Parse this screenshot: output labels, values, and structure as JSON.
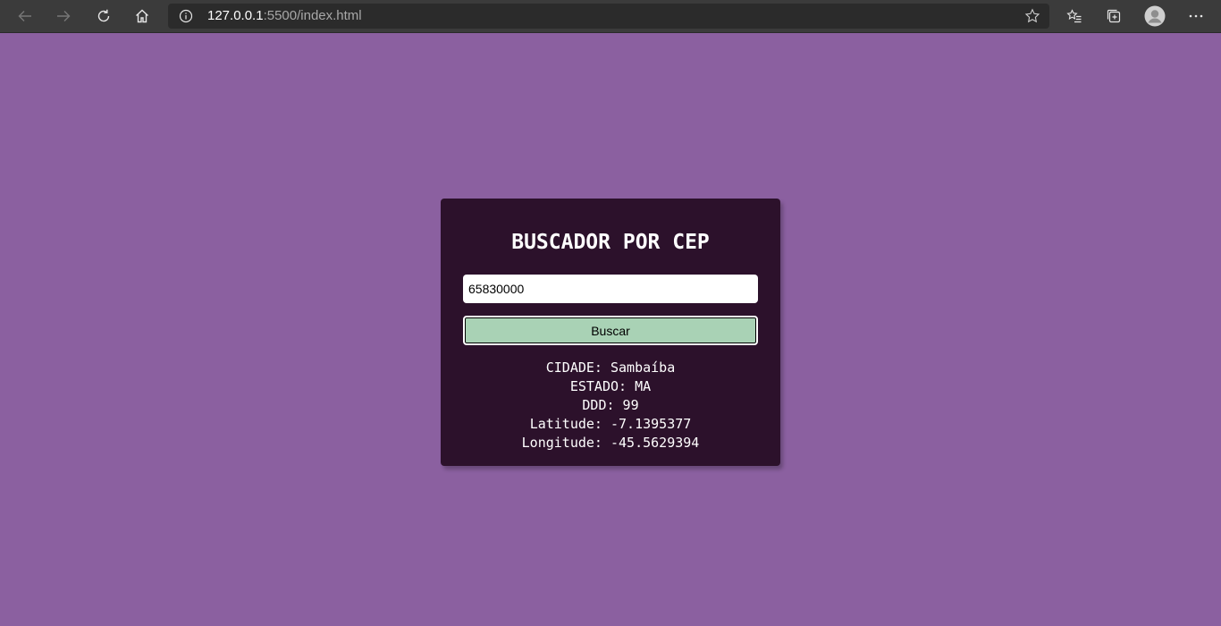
{
  "browser": {
    "url_host": "127.0.0.1",
    "url_rest": ":5500/index.html"
  },
  "app": {
    "title": "BUSCADOR POR CEP",
    "cep_value": "65830000",
    "button_label": "Buscar",
    "results": [
      {
        "label": "CIDADE:",
        "value": "Sambaíba"
      },
      {
        "label": "ESTADO:",
        "value": "MA"
      },
      {
        "label": "DDD:",
        "value": "99"
      },
      {
        "label": "Latitude:",
        "value": "-7.1395377"
      },
      {
        "label": "Longitude:",
        "value": "-45.5629394"
      }
    ]
  },
  "colors": {
    "page_background": "#8b60a0",
    "card_background": "#2c112b",
    "button_background": "#a9d2b5",
    "toolbar_background": "#3b3b3b"
  },
  "icons": [
    "back-icon",
    "forward-icon",
    "refresh-icon",
    "home-icon",
    "info-icon",
    "favorite-star-icon",
    "favorites-icon",
    "collections-icon",
    "profile-icon",
    "more-icon"
  ]
}
